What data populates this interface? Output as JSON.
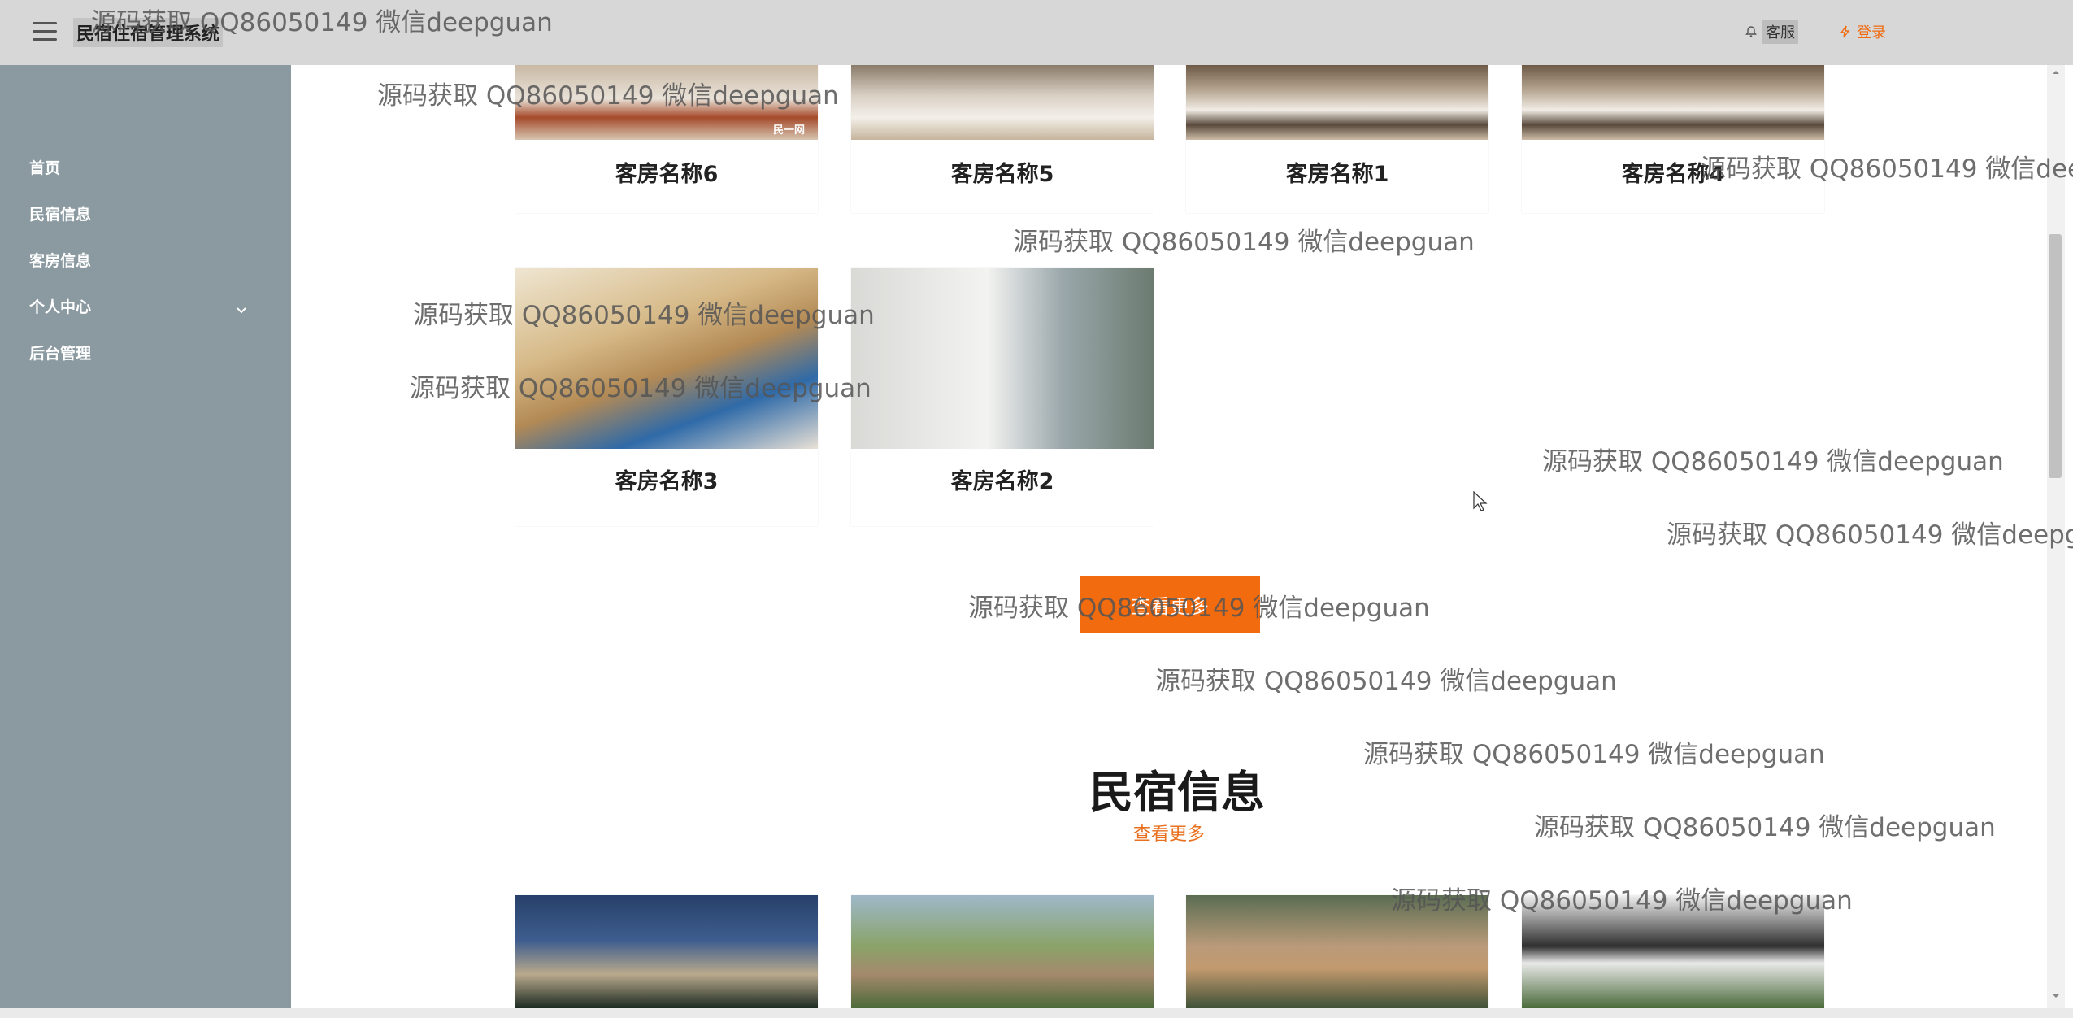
{
  "header": {
    "app_title": "民宿住宿管理系统",
    "service_label": "客服",
    "login_label": "登录"
  },
  "sidebar": {
    "items": [
      {
        "label": "首页"
      },
      {
        "label": "民宿信息"
      },
      {
        "label": "客房信息"
      },
      {
        "label": "个人中心"
      },
      {
        "label": "后台管理"
      }
    ]
  },
  "rooms": [
    {
      "name": "客房名称6",
      "badge": "民一网"
    },
    {
      "name": "客房名称5"
    },
    {
      "name": "客房名称1"
    },
    {
      "name": "客房名称4"
    },
    {
      "name": "客房名称3"
    },
    {
      "name": "客房名称2"
    }
  ],
  "load_more_label": "查看更多",
  "homestay_section": {
    "title": "民宿信息",
    "see_more": "查看更多"
  },
  "watermark": "源码获取 QQ86050149 微信deepguan",
  "colors": {
    "accent": "#f26b0f",
    "sidebar": "#8a9aa0",
    "topbar": "#d7d7d7"
  }
}
